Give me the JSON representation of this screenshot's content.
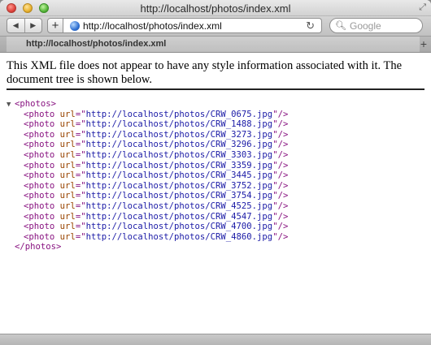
{
  "window": {
    "title": "http://localhost/photos/index.xml"
  },
  "toolbar": {
    "back_icon": "◀",
    "forward_icon": "▶",
    "add_icon": "+",
    "url": "http://localhost/photos/index.xml",
    "reload_icon": "↻",
    "search_placeholder": "Google",
    "search_icon": "🔍︎"
  },
  "tab": {
    "label": "http://localhost/photos/index.xml",
    "newtab_icon": "+"
  },
  "notice": "This XML file does not appear to have any style information associated with it. The document tree is shown below.",
  "xml": {
    "root_tag": "photos",
    "attr_name": "url",
    "child_tag": "photo",
    "photos": [
      "http://localhost/photos/CRW_0675.jpg",
      "http://localhost/photos/CRW_1488.jpg",
      "http://localhost/photos/CRW_3273.jpg",
      "http://localhost/photos/CRW_3296.jpg",
      "http://localhost/photos/CRW_3303.jpg",
      "http://localhost/photos/CRW_3359.jpg",
      "http://localhost/photos/CRW_3445.jpg",
      "http://localhost/photos/CRW_3752.jpg",
      "http://localhost/photos/CRW_3754.jpg",
      "http://localhost/photos/CRW_4525.jpg",
      "http://localhost/photos/CRW_4547.jpg",
      "http://localhost/photos/CRW_4700.jpg",
      "http://localhost/photos/CRW_4860.jpg"
    ]
  },
  "colors": {
    "tag": "#881280",
    "attr": "#994500",
    "value": "#1a1aa6"
  }
}
